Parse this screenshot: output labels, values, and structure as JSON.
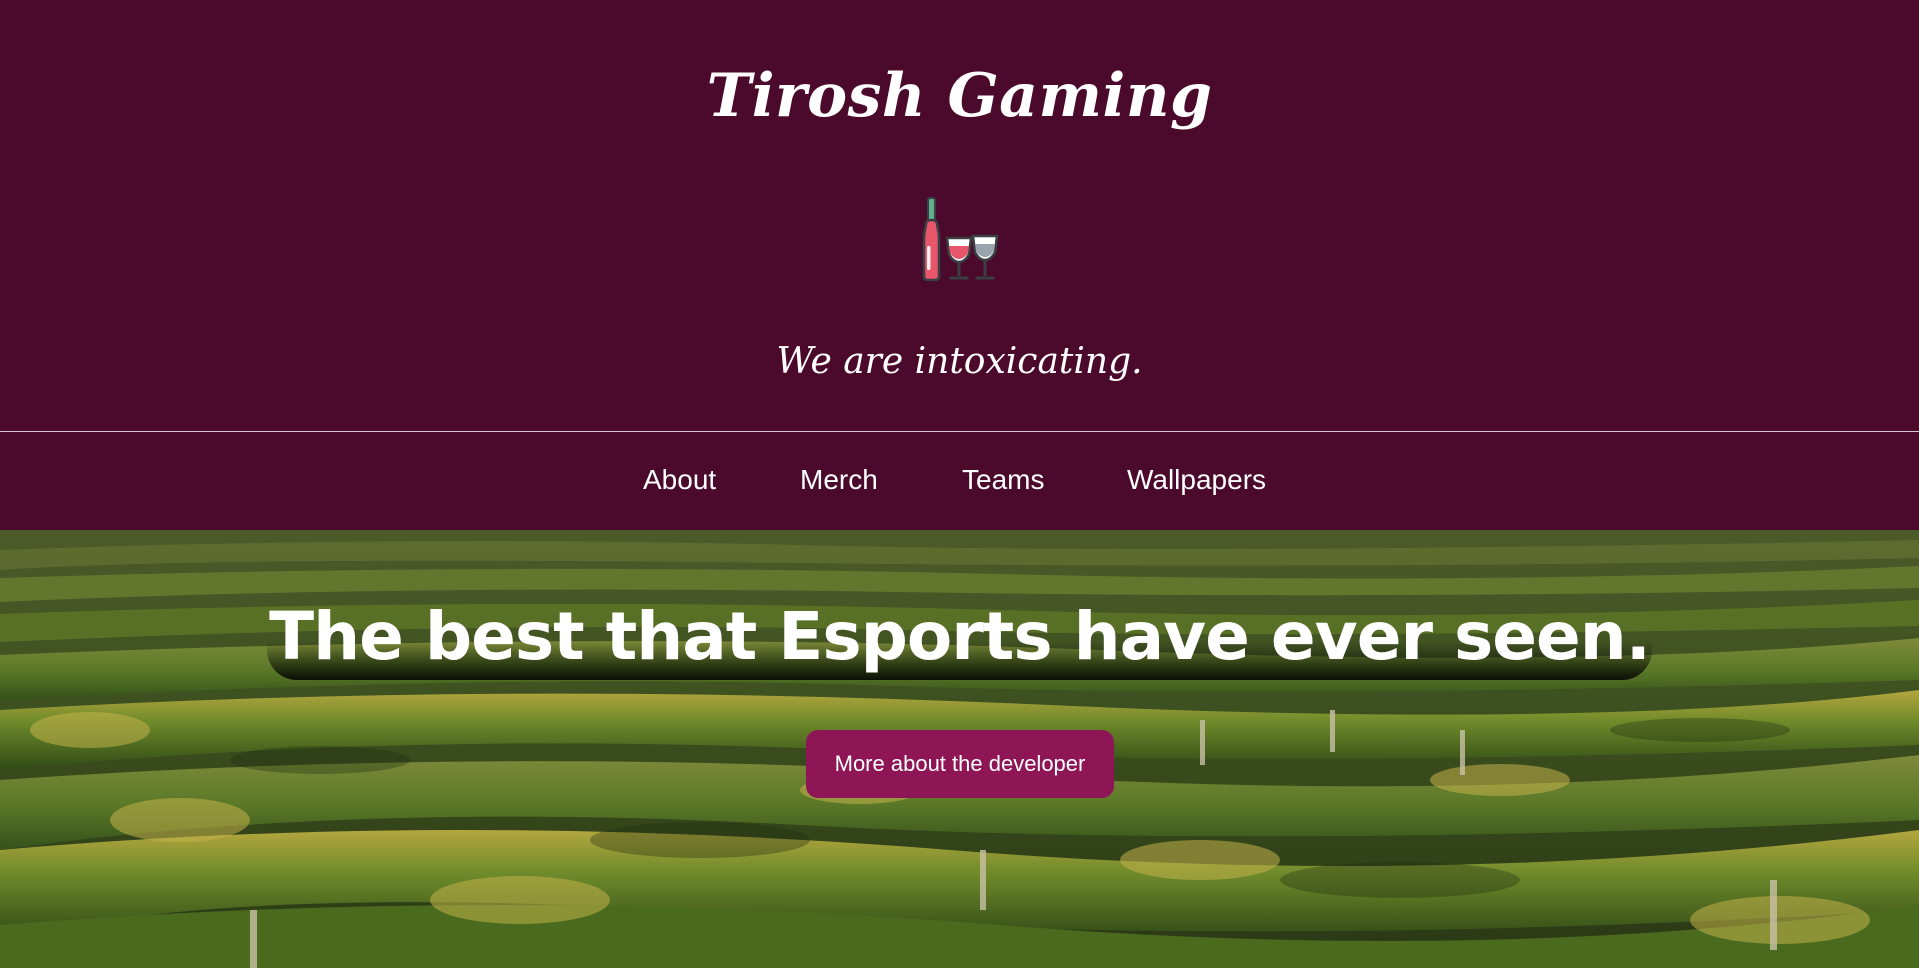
{
  "header": {
    "title": "Tirosh Gaming",
    "logo_icon": "wine-bottle-and-glasses-icon",
    "tagline": "We are intoxicating."
  },
  "nav": {
    "items": [
      {
        "label": "About"
      },
      {
        "label": "Merch"
      },
      {
        "label": "Teams"
      },
      {
        "label": "Wallpapers"
      }
    ]
  },
  "hero": {
    "headline": "The best that Esports have ever seen.",
    "cta_label": "More about the developer",
    "background_image": "vineyard-rows"
  },
  "colors": {
    "header_background": "#4b0a2c",
    "button_background": "#8f1656",
    "text": "#ffffff"
  }
}
